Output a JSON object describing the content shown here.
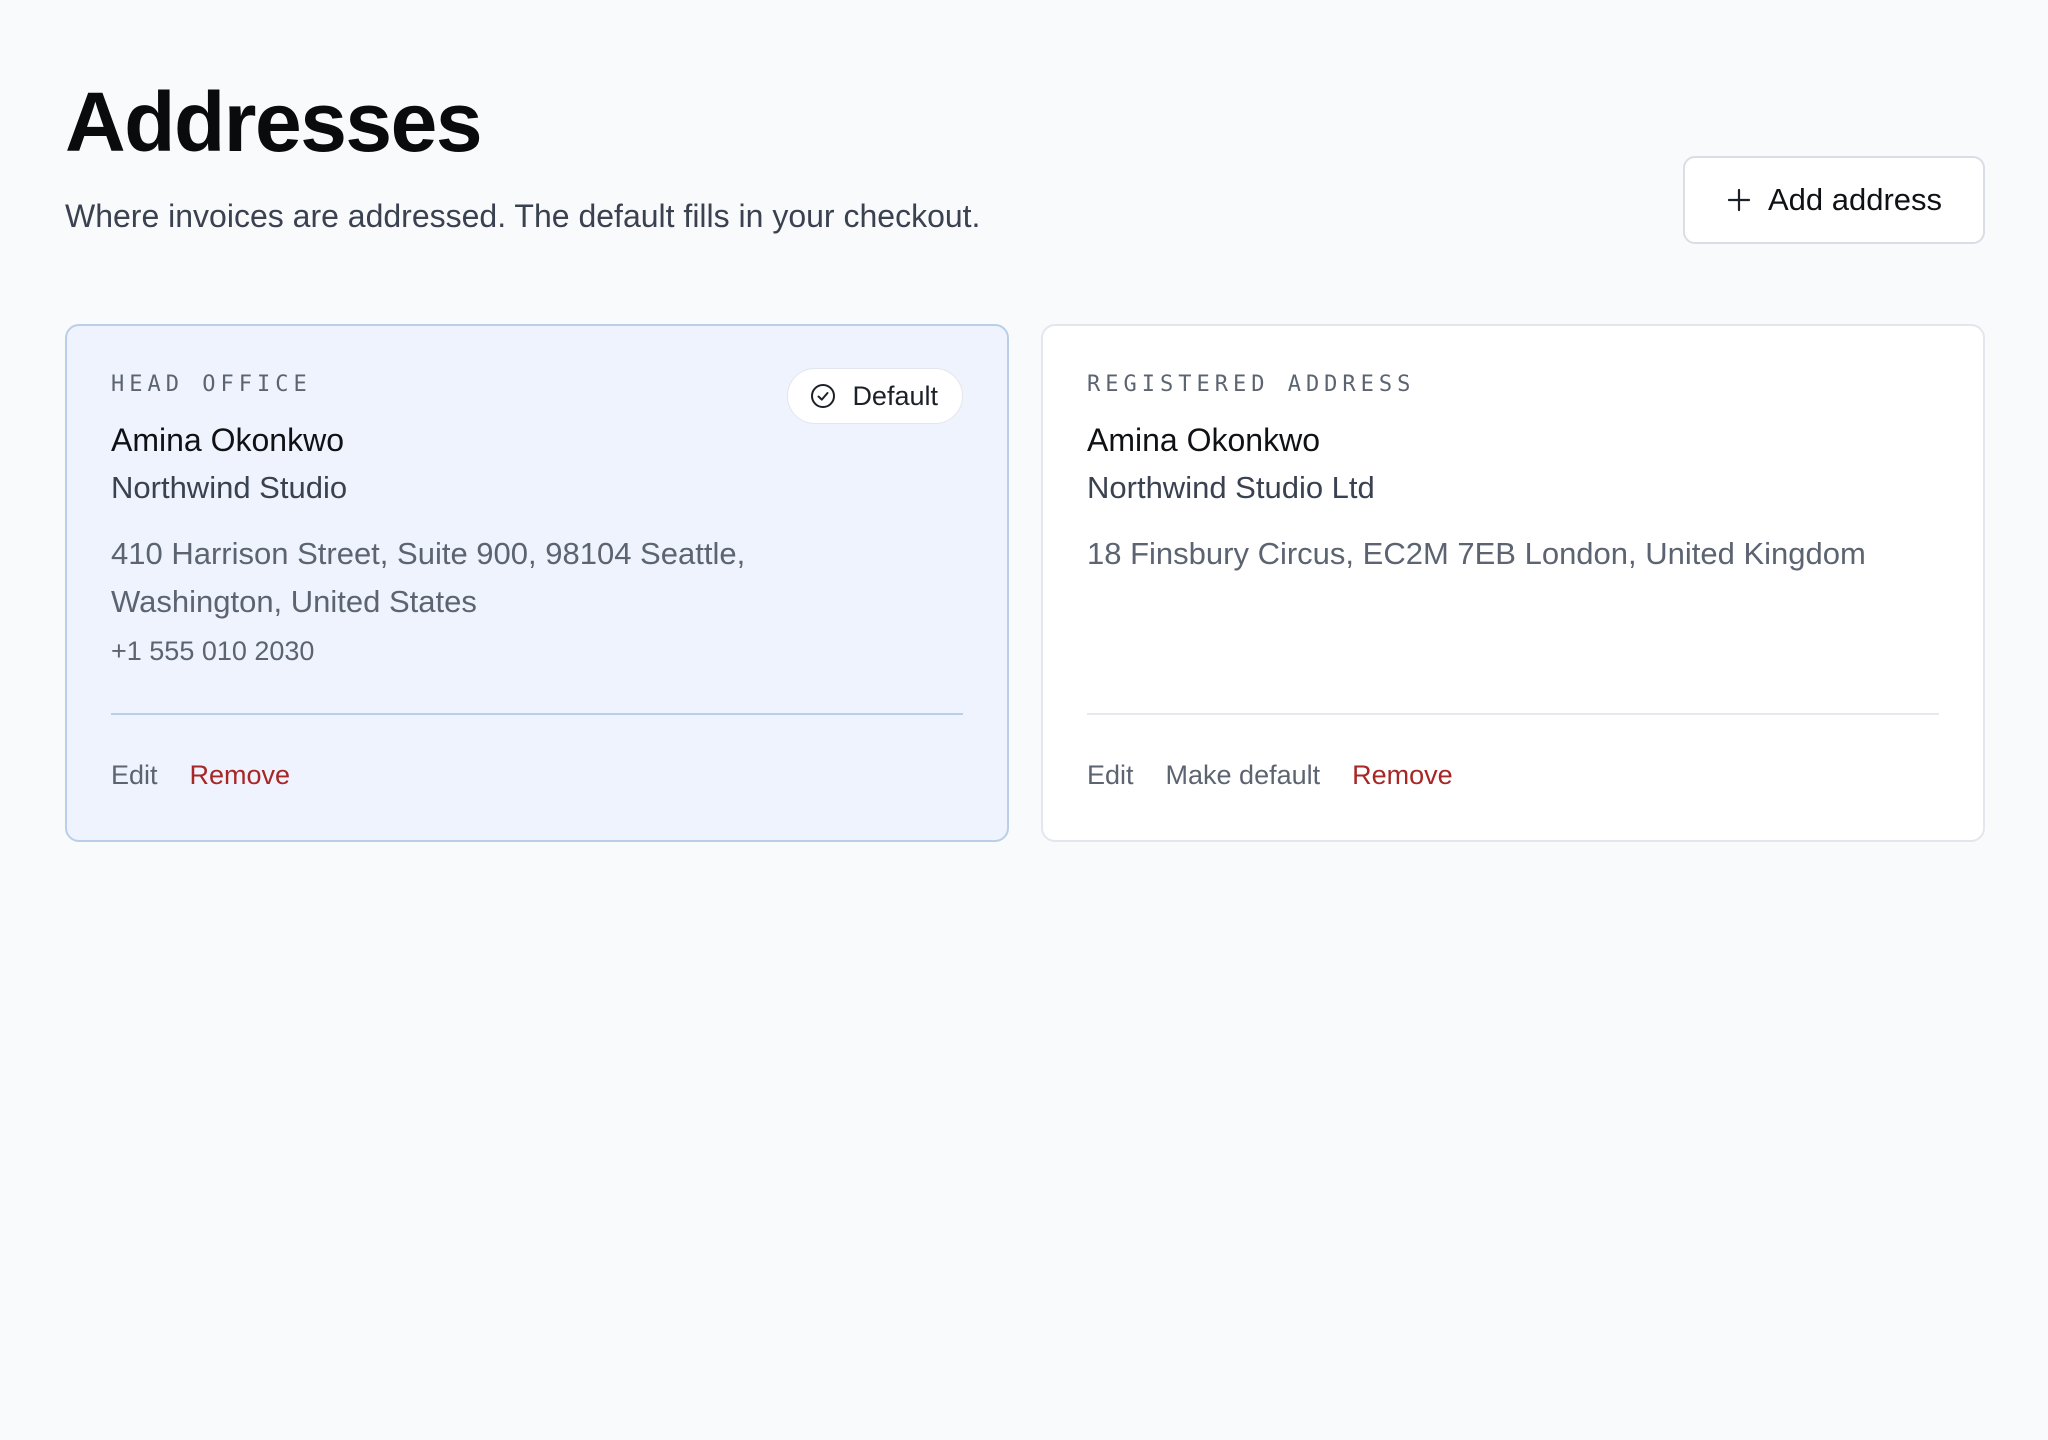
{
  "header": {
    "title": "Addresses",
    "subtitle": "Where invoices are addressed. The default fills in your checkout.",
    "add_button_label": "Add address"
  },
  "addresses": [
    {
      "label": "HEAD OFFICE",
      "name": "Amina Okonkwo",
      "company": "Northwind Studio",
      "address": "410 Harrison Street, Suite 900, 98104 Seattle, Washington, United States",
      "phone": "+1 555 010 2030",
      "is_default": true,
      "badge": "Default",
      "actions": {
        "edit": "Edit",
        "remove": "Remove"
      }
    },
    {
      "label": "REGISTERED ADDRESS",
      "name": "Amina Okonkwo",
      "company": "Northwind Studio Ltd",
      "address": "18 Finsbury Circus, EC2M 7EB London, United Kingdom",
      "is_default": false,
      "actions": {
        "edit": "Edit",
        "make_default": "Make default",
        "remove": "Remove"
      }
    }
  ],
  "colors": {
    "background": "#f9fafc",
    "default_card_bg": "#eff3fd",
    "default_card_border": "#b9cfe8",
    "danger": "#a72626",
    "muted_text": "#5c6472"
  },
  "icons": {
    "add": "plus-icon",
    "default": "check-circle-icon"
  }
}
